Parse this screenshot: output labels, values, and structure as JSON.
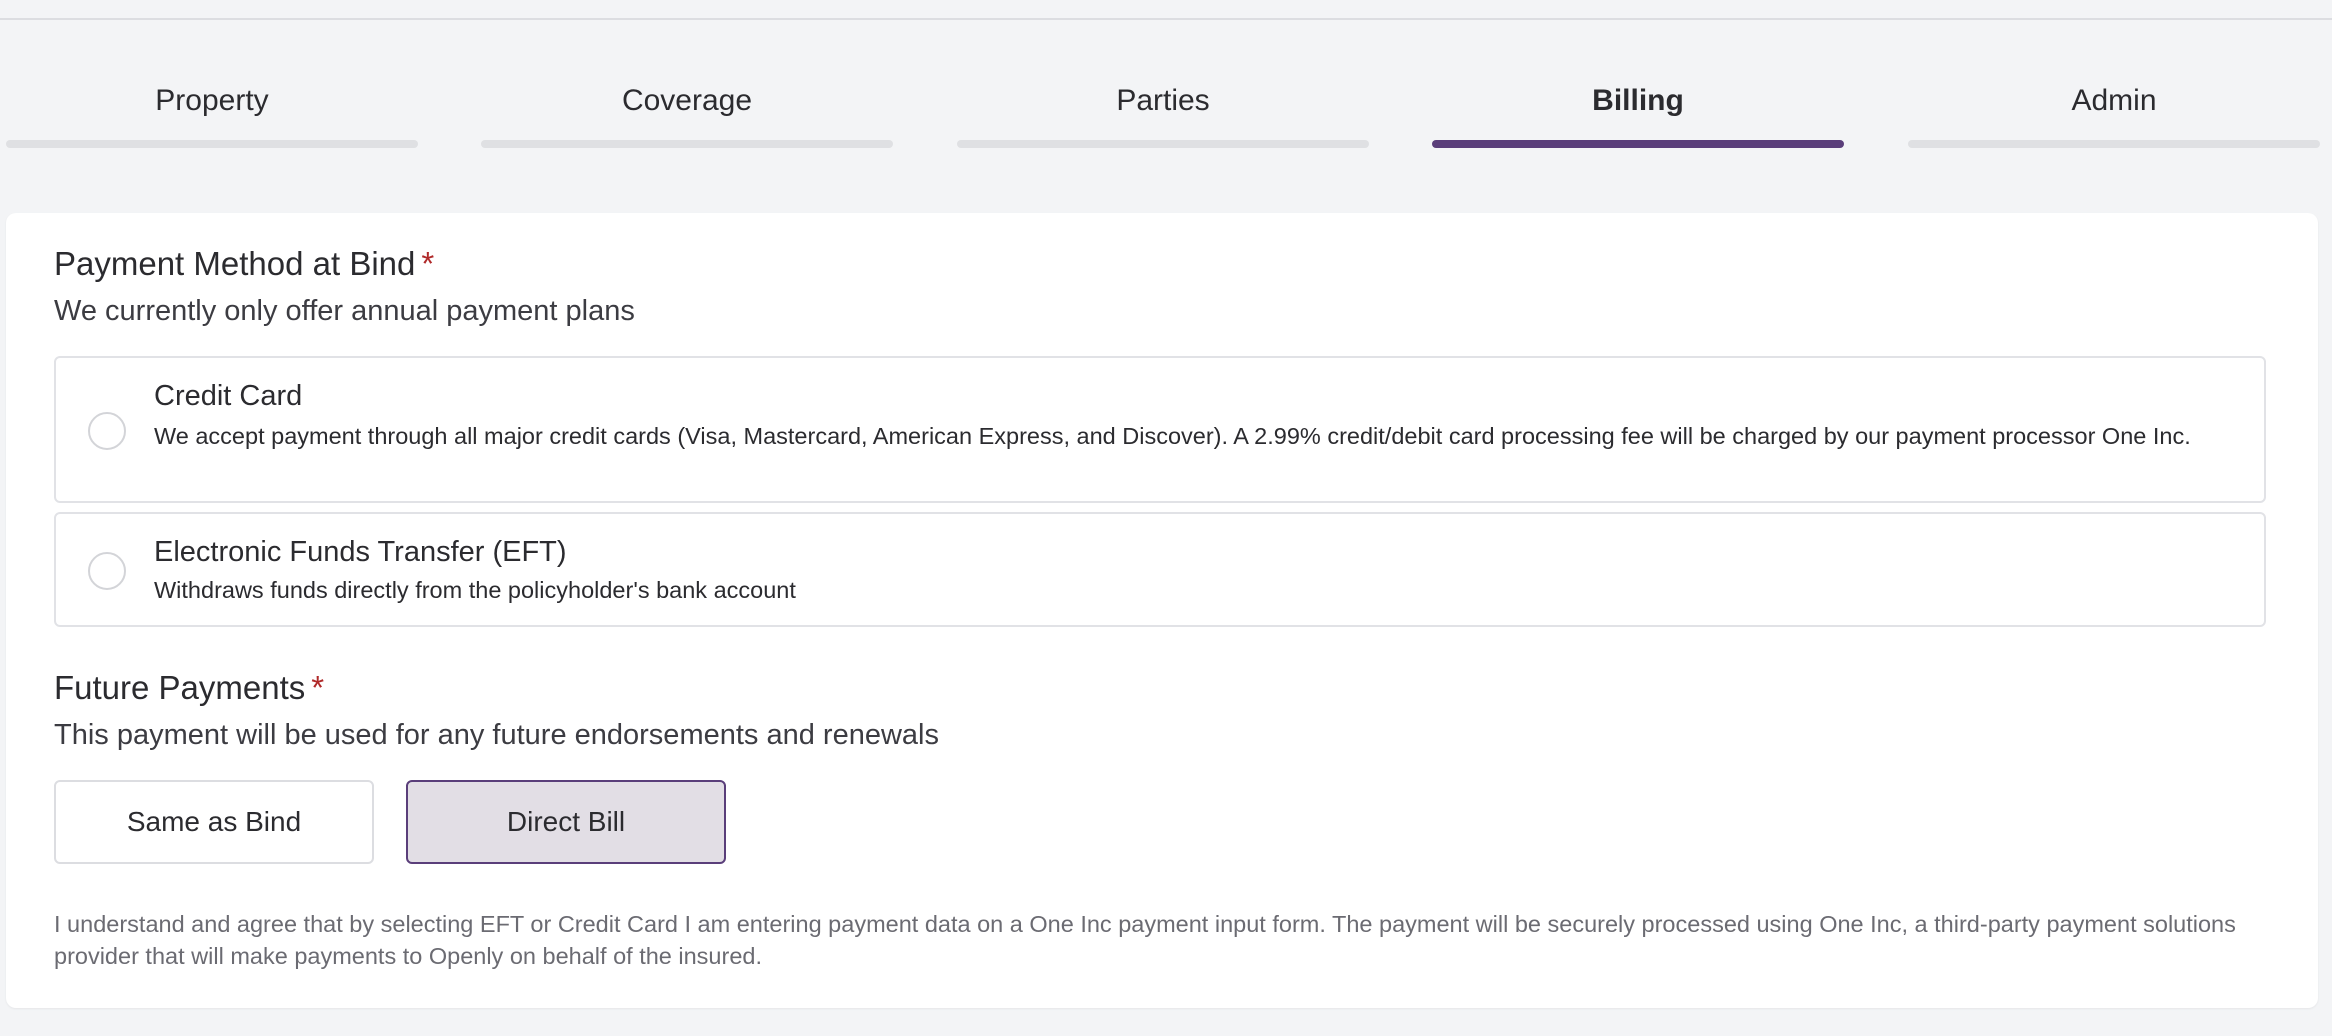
{
  "tabs": [
    {
      "label": "Property",
      "active": false
    },
    {
      "label": "Coverage",
      "active": false
    },
    {
      "label": "Parties",
      "active": false
    },
    {
      "label": "Billing",
      "active": true
    },
    {
      "label": "Admin",
      "active": false
    }
  ],
  "payment_method": {
    "title": "Payment Method at Bind",
    "required_mark": "*",
    "subtitle": "We currently only offer annual payment plans",
    "options": [
      {
        "title": "Credit Card",
        "description": "We accept payment through all major credit cards (Visa, Mastercard, American Express, and Discover). A 2.99% credit/debit card processing fee will be charged by our payment processor One Inc.",
        "selected": false
      },
      {
        "title": "Electronic Funds Transfer (EFT)",
        "description": "Withdraws funds directly from the policyholder's bank account",
        "selected": false
      }
    ]
  },
  "future_payments": {
    "title": "Future Payments",
    "required_mark": "*",
    "subtitle": "This payment will be used for any future endorsements and renewals",
    "choices": [
      {
        "label": "Same as Bind",
        "selected": false
      },
      {
        "label": "Direct Bill",
        "selected": true
      }
    ]
  },
  "disclaimer": "I understand and agree that by selecting EFT or Credit Card I am entering payment data on a One Inc payment input form. The payment will be securely processed using One Inc, a third-party payment solutions provider that will make payments to Openly on behalf of the insured.",
  "colors": {
    "accent": "#5a3e7a",
    "required": "#b02a2a",
    "page_background": "#f3f4f6",
    "selected_background": "#e2dee5"
  }
}
